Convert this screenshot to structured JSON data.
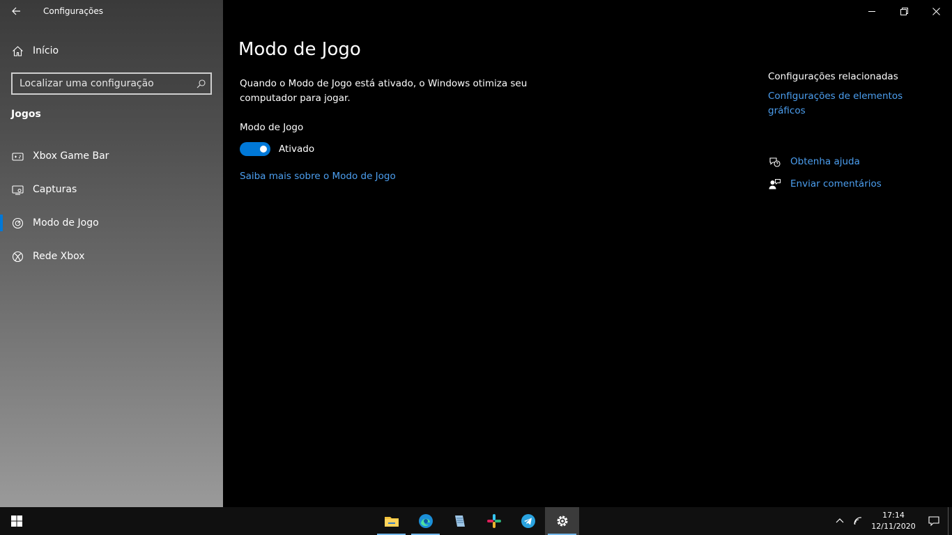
{
  "app": {
    "title": "Configurações"
  },
  "sidebar": {
    "home_label": "Início",
    "search_placeholder": "Localizar uma configuração",
    "section_title": "Jogos",
    "items": [
      {
        "label": "Xbox Game Bar",
        "icon": "xbox-game-bar-icon"
      },
      {
        "label": "Capturas",
        "icon": "captures-icon"
      },
      {
        "label": "Modo de Jogo",
        "icon": "game-mode-icon",
        "selected": true
      },
      {
        "label": "Rede Xbox",
        "icon": "xbox-icon"
      }
    ]
  },
  "main": {
    "title": "Modo de Jogo",
    "description": "Quando o Modo de Jogo está ativado, o Windows otimiza seu computador para jogar.",
    "toggle_title": "Modo de Jogo",
    "toggle_state": "Ativado",
    "toggle_on": true,
    "learn_more": "Saiba mais sobre o Modo de Jogo"
  },
  "related": {
    "title": "Configurações relacionadas",
    "link": "Configurações de elementos gráficos"
  },
  "help": {
    "get_help": "Obtenha ajuda",
    "feedback": "Enviar comentários"
  },
  "taskbar": {
    "apps": [
      "file-explorer-icon",
      "edge-icon",
      "notepad-icon",
      "slack-icon",
      "telegram-icon",
      "settings-icon"
    ],
    "time": "17:14",
    "date": "12/11/2020"
  },
  "colors": {
    "accent": "#0078d7",
    "link": "#4c9ff0",
    "background": "#000000"
  }
}
